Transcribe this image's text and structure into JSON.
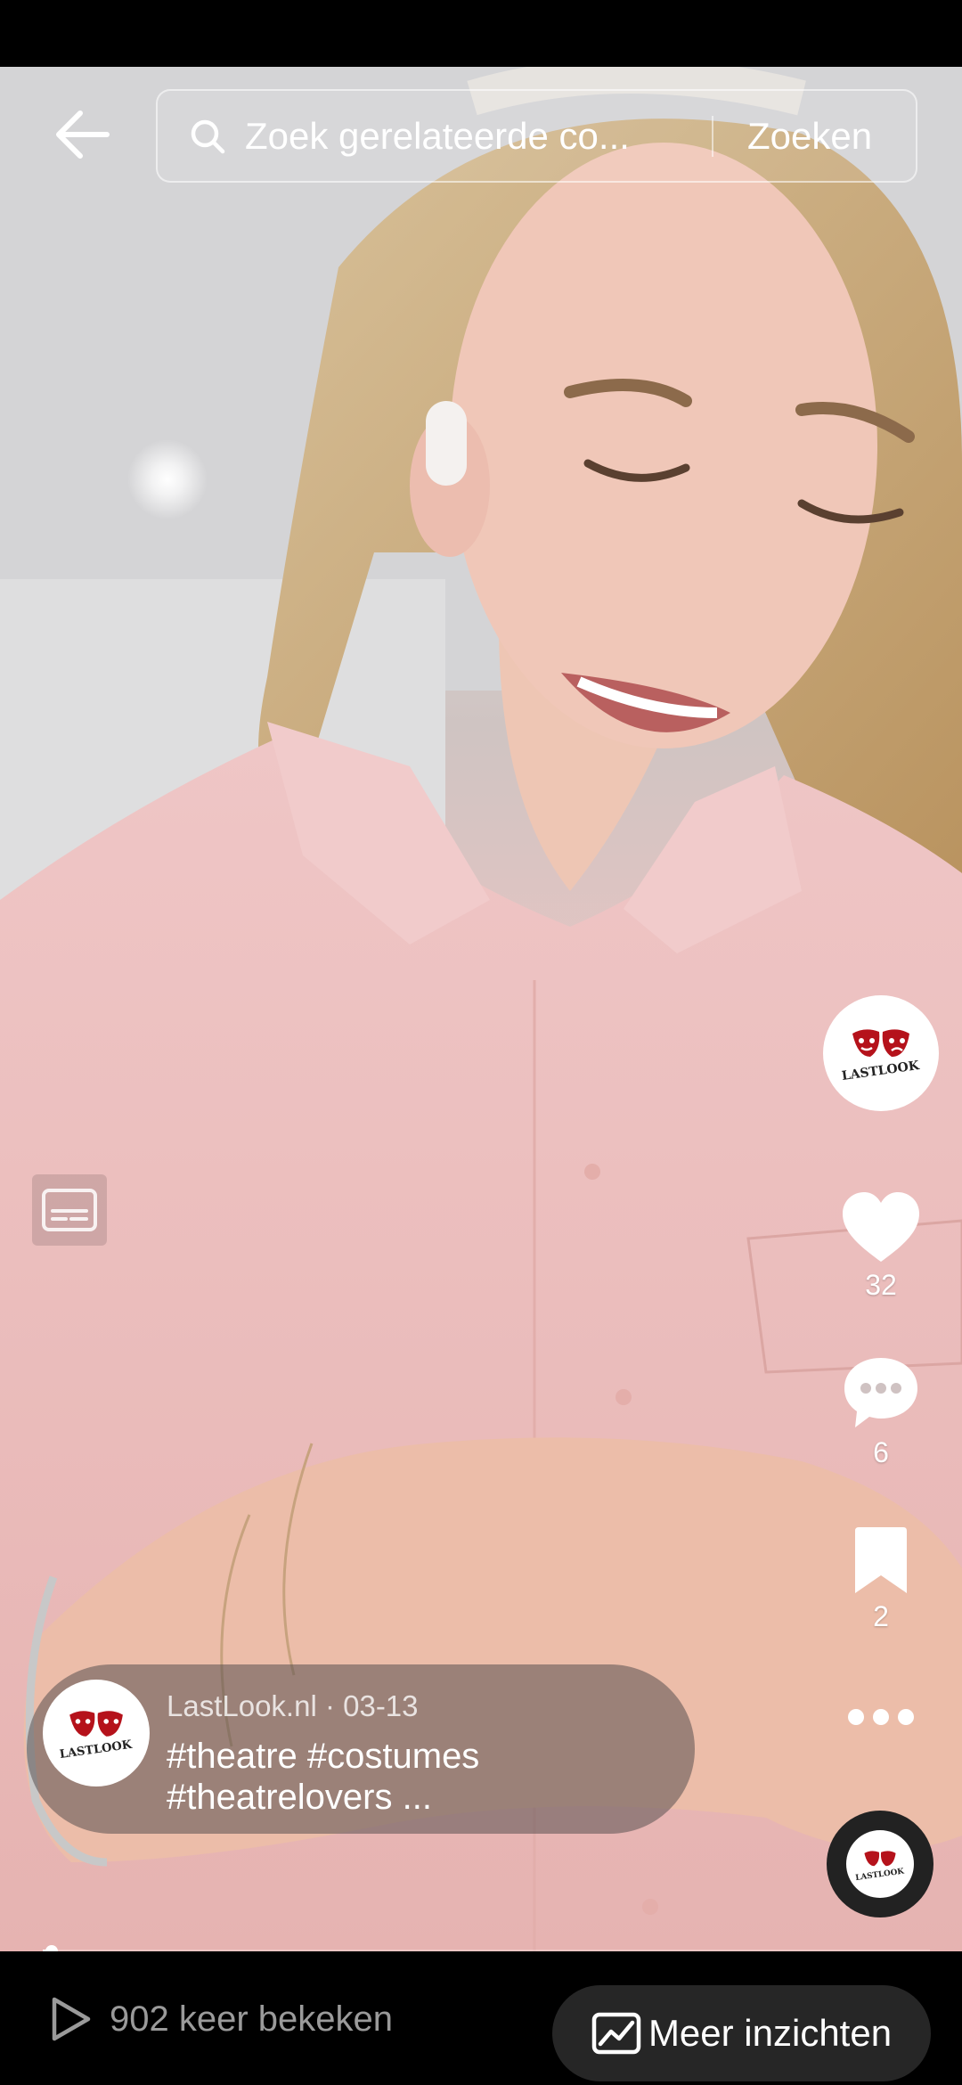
{
  "search": {
    "placeholder": "Zoek gerelateerde co...",
    "button_label": "Zoeken"
  },
  "video": {
    "description": "Woman in pink shirt looking down at her wrist"
  },
  "actions": {
    "likes": "32",
    "comments": "6",
    "saves": "2"
  },
  "post": {
    "author": "LastLook.nl",
    "date": "03-13",
    "meta": "LastLook.nl · 03-13",
    "caption_line1": "#theatre #costumes",
    "caption_line2": "#theatrelovers ...",
    "logo_text": "LASTLOOK"
  },
  "progress": {
    "played_fraction": 0.01
  },
  "footer": {
    "views_text": "902 keer bekeken",
    "insights_label": "Meer inzichten"
  },
  "colors": {
    "logo_red": "#b5121b",
    "muted_text": "#9a9a9a",
    "bar_bg": "#000000"
  }
}
